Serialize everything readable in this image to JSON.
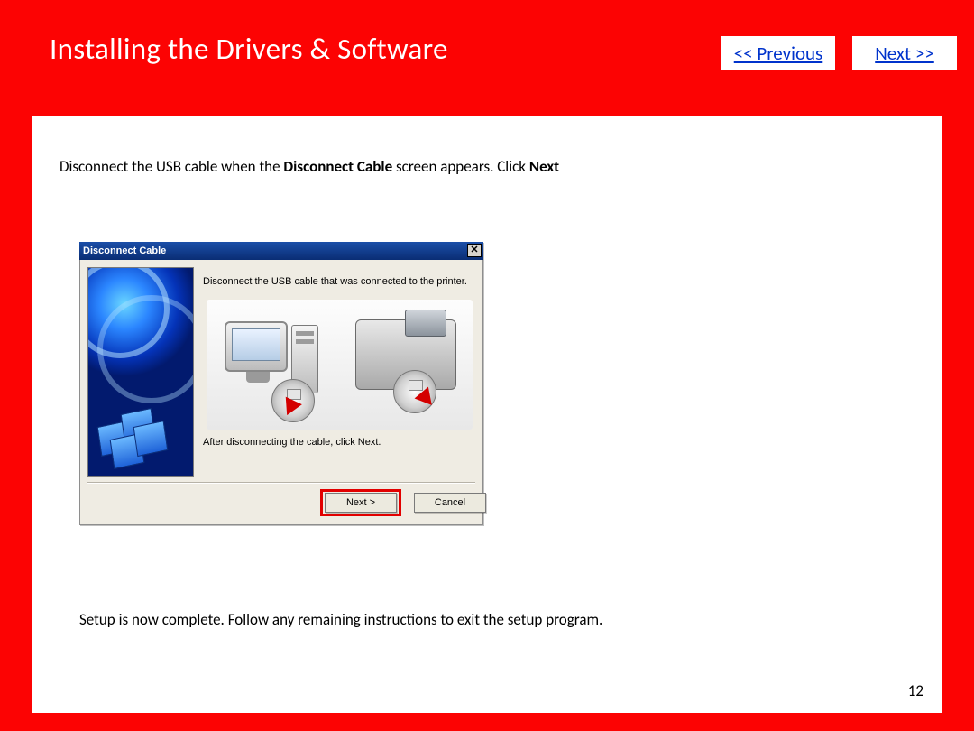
{
  "header": {
    "title": "Installing  the Drivers & Software",
    "prev_label": "<< Previous",
    "next_label": "Next >>"
  },
  "instructions": {
    "line1_prefix": "Disconnect the USB cable when the ",
    "line1_bold1": "Disconnect Cable",
    "line1_mid": " screen appears.  Click ",
    "line1_bold2": "Next",
    "line2": "Setup is now complete.  Follow any remaining instructions to exit the setup program."
  },
  "dialog": {
    "title": "Disconnect Cable",
    "message_top": "Disconnect the USB cable that was connected to the printer.",
    "message_bottom": "After disconnecting the cable, click Next.",
    "next_label": "Next >",
    "cancel_label": "Cancel",
    "close_glyph": "✕"
  },
  "page_number": "12"
}
